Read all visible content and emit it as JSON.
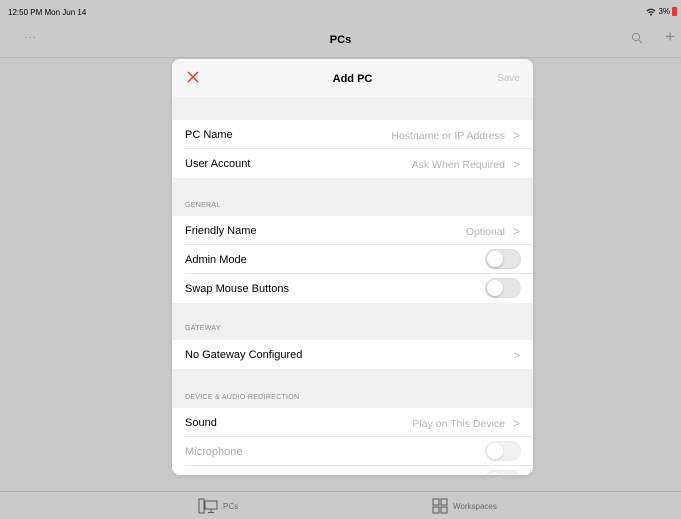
{
  "status_bar": {
    "time": "12:50 PM  Mon Jun 14",
    "battery": "3%"
  },
  "nav": {
    "title": "PCs",
    "more_label": "···"
  },
  "modal": {
    "title": "Add PC",
    "save_label": "Save",
    "rows": {
      "pc_name": {
        "label": "PC Name",
        "value": "Hostname or IP Address"
      },
      "user_account": {
        "label": "User Account",
        "value": "Ask When Required"
      },
      "friendly_name": {
        "label": "Friendly Name",
        "value": "Optional"
      },
      "admin_mode": {
        "label": "Admin Mode",
        "on": false
      },
      "swap_mouse": {
        "label": "Swap Mouse Buttons",
        "on": false
      },
      "gateway": {
        "label": "No Gateway Configured"
      },
      "sound": {
        "label": "Sound",
        "value": "Play on This Device"
      },
      "microphone": {
        "label": "Microphone",
        "on": false
      }
    },
    "sections": {
      "general": "GENERAL",
      "gateway": "GATEWAY",
      "device_audio": "DEVICE & AUDIO REDIRECTION"
    },
    "chevron": ">"
  },
  "tabs": {
    "pcs": "PCs",
    "workspaces": "Workspaces"
  },
  "icons": {
    "close": "close-icon",
    "search": "search-icon",
    "add": "plus-icon",
    "pcs": "monitor-icon",
    "workspaces": "grid-icon",
    "wifi": "wifi-icon"
  },
  "colors": {
    "accent_red": "#e53935",
    "background": "#c9c9c9",
    "disabled_text": "#b3b3b3"
  }
}
